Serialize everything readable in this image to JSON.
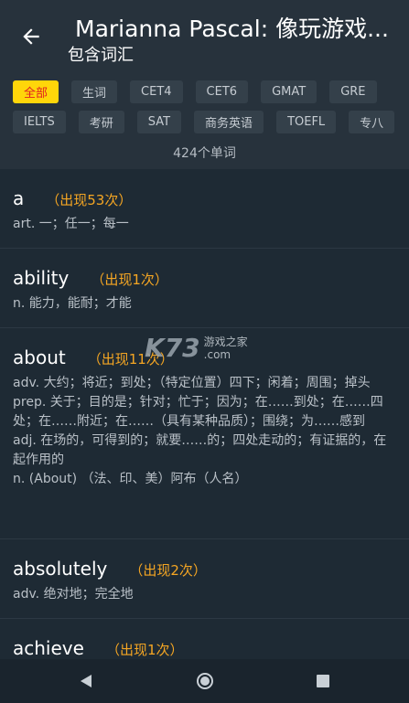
{
  "header": {
    "title": "Marianna Pascal: 像玩游戏...",
    "subtitle": "包含词汇"
  },
  "filters": {
    "row1": [
      "全部",
      "生词",
      "CET4",
      "CET6",
      "GMAT",
      "GRE"
    ],
    "row2": [
      "IELTS",
      "考研",
      "SAT",
      "商务英语",
      "TOEFL",
      "专八"
    ],
    "active": "全部"
  },
  "word_count": "424个单词",
  "entries": [
    {
      "word": "a",
      "freq": "（出现53次）",
      "defs": [
        "art. 一；任一；每一"
      ]
    },
    {
      "word": "ability",
      "freq": "（出现1次）",
      "defs": [
        "n. 能力，能耐；才能"
      ]
    },
    {
      "word": "about",
      "freq": "（出现11次）",
      "defs": [
        "adv. 大约；将近；到处；（特定位置）四下；闲着；周围；掉头",
        "prep. 关于；目的是；针对；忙于；因为；在……到处；在……四处；在……附近；在……（具有某种品质）；围绕；为……感到",
        "adj. 在场的，可得到的；就要……的；四处走动的；有证据的，在起作用的",
        "n. (About) （法、印、美）阿布（人名）"
      ]
    },
    {
      "word": "absolutely",
      "freq": "（出现2次）",
      "defs": [
        "adv. 绝对地；完全地"
      ]
    },
    {
      "word": "achieve",
      "freq": "（出现1次）",
      "defs": []
    }
  ],
  "watermark": {
    "logo": "K73",
    "cn": "游戏之家",
    "en": ".com"
  },
  "colors": {
    "active_chip_bg": "#ffd60a",
    "active_chip_text": "#e02020",
    "freq": "#f5a623"
  }
}
